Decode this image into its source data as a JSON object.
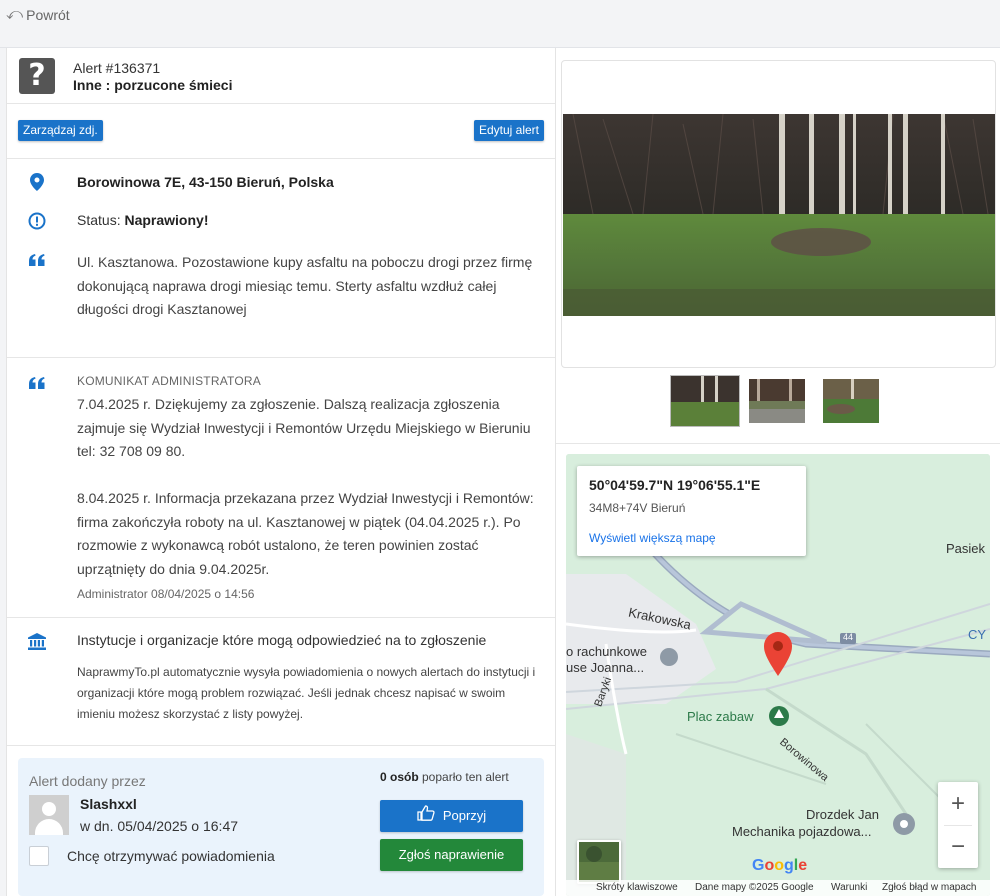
{
  "nav": {
    "back_label": "Powrót"
  },
  "alert": {
    "id_label": "Alert #136371",
    "category": "Inne : porzucone śmieci",
    "manage_photos_label": "Zarządzaj zdj.",
    "edit_label": "Edytuj alert",
    "address": "Borowinowa 7E, 43-150 Bieruń, Polska",
    "status_prefix": "Status: ",
    "status_value": "Naprawiony!",
    "description": "Ul. Kasztanowa. Pozostawione kupy asfaltu na poboczu drogi przez firmę dokonującą naprawa drogi miesiąc temu. Sterty asfaltu wzdłuż całej długości drogi Kasztanowej"
  },
  "admin": {
    "heading": "KOMUNIKAT ADMINISTRATORA",
    "paragraph1": "7.04.2025 r. Dziękujemy za zgłoszenie. Dalszą realizacja zgłoszenia zajmuje się Wydział Inwestycji i Remontów Urzędu Miejskiego w Bieruniu tel: 32 708 09 80.",
    "paragraph2": "8.04.2025 r. Informacja przekazana przez Wydział Inwestycji i Remontów: firma zakończyła roboty na ul. Kasztanowej w piątek (04.04.2025 r.). Po rozmowie z wykonawcą robót ustalono, że teren powinien zostać uprzątnięty do dnia 9.04.2025r.",
    "signature": "Administrator 08/04/2025 o 14:56"
  },
  "institutions": {
    "heading": "Instytucje i organizacje które mogą odpowiedzieć na to zgłoszenie",
    "body": "NaprawmyTo.pl automatycznie wysyła powiadomienia o nowych alertach do instytucji i organizacji które mogą problem rozwiązać. Jeśli jednak chcesz napisać w swoim imieniu możesz skorzystać z listy powyżej."
  },
  "author": {
    "heading": "Alert dodany przez",
    "name": "Slashxxl",
    "date": "w dn. 05/04/2025 o 16:47",
    "notify_label": "Chcę otrzymywać powiadomienia",
    "notify_checked": false
  },
  "support": {
    "count": "0 osób",
    "suffix": " poparło ten alert",
    "support_button": "Poprzyj",
    "report_fixed_button": "Zgłoś naprawienie"
  },
  "map": {
    "coords": "50°04'59.7\"N 19°06'55.1\"E",
    "plus_code": "34M8+74V Bieruń",
    "bigger_map_link": "Wyświetl większą mapę",
    "labels": {
      "krakowska": "Krakowska",
      "road_number": "44",
      "rachunkowe_1": "o rachunkowe",
      "rachunkowe_2": "use Joanna...",
      "baryki": "Baryki",
      "plac_zabaw": "Plac zabaw",
      "borowinowa": "Borowinowa",
      "drozdek_1": "Drozdek Jan",
      "drozdek_2": "Mechanika pojazdowa...",
      "pasiek": "Pasiek",
      "cy": "CY"
    },
    "zoom_in": "+",
    "zoom_out": "−",
    "google": "Google",
    "footer": {
      "shortcuts": "Skróty klawiszowe",
      "data": "Dane mapy ©2025 Google",
      "terms": "Warunki",
      "report": "Zgłoś błąd w mapach"
    }
  },
  "colors": {
    "primary": "#1a73c9",
    "success": "#23883a",
    "card_bg": "#eaf3fc",
    "map_bg": "#d9efe0",
    "pin": "#ea4335"
  }
}
